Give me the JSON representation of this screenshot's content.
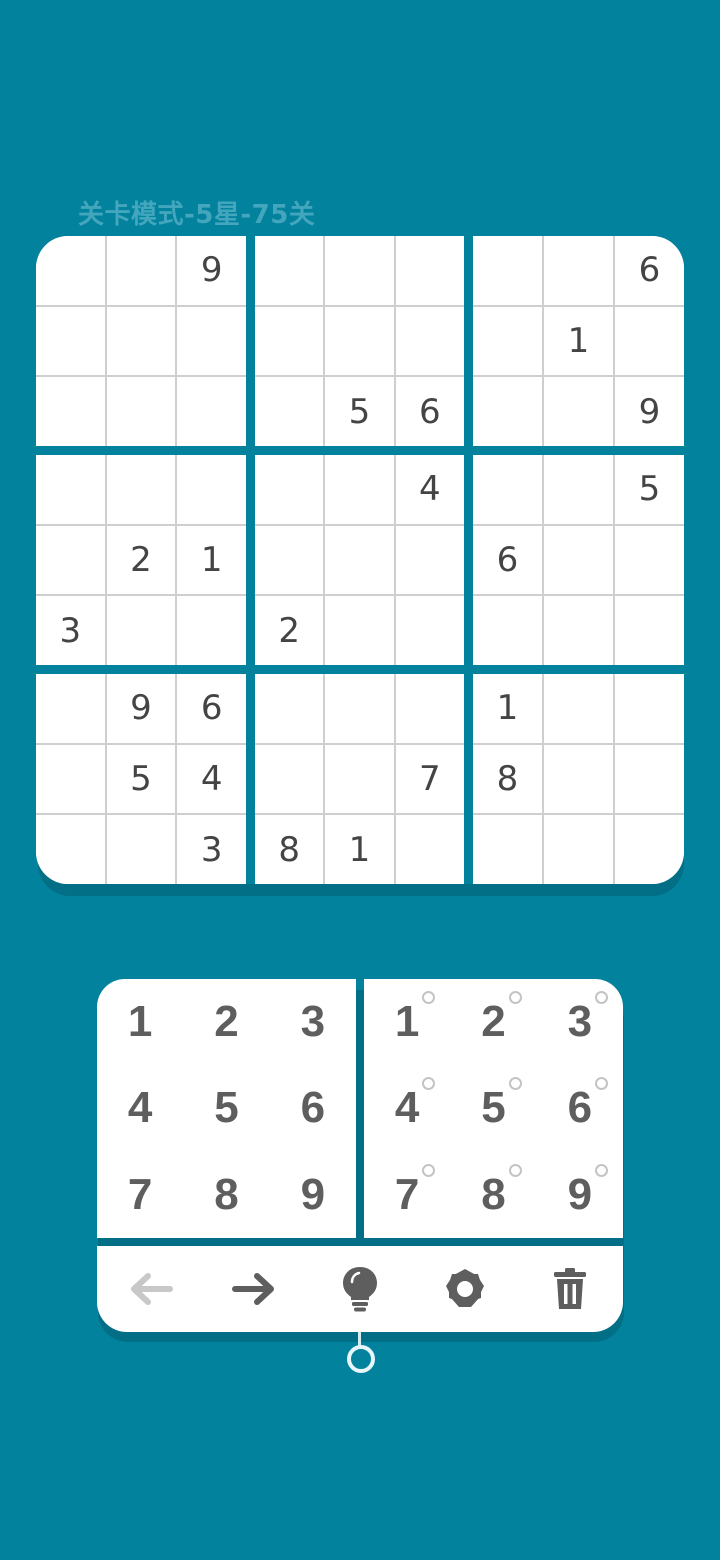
{
  "level_title": "关卡模式-5星-75关",
  "board": {
    "grid": [
      [
        "",
        "",
        "9",
        "",
        "",
        "",
        "",
        "",
        "6"
      ],
      [
        "",
        "",
        "",
        "",
        "",
        "",
        "",
        "1",
        ""
      ],
      [
        "",
        "",
        "",
        "",
        "5",
        "6",
        "",
        "",
        "9"
      ],
      [
        "",
        "",
        "",
        "",
        "",
        "4",
        "",
        "",
        "5"
      ],
      [
        "",
        "2",
        "1",
        "",
        "",
        "",
        "6",
        "",
        ""
      ],
      [
        "3",
        "",
        "",
        "2",
        "",
        "",
        "",
        "",
        ""
      ],
      [
        "",
        "9",
        "6",
        "",
        "",
        "",
        "1",
        "",
        ""
      ],
      [
        "",
        "5",
        "4",
        "",
        "",
        "7",
        "8",
        "",
        ""
      ],
      [
        "",
        "",
        "3",
        "8",
        "1",
        "",
        "",
        "",
        ""
      ]
    ]
  },
  "keypad": {
    "numbers": [
      "1",
      "2",
      "3",
      "4",
      "5",
      "6",
      "7",
      "8",
      "9"
    ],
    "note_numbers": [
      "1",
      "2",
      "3",
      "4",
      "5",
      "6",
      "7",
      "8",
      "9"
    ]
  },
  "toolbar": {
    "tools": [
      {
        "name": "undo-button",
        "icon": "arrow-left-icon",
        "enabled": false
      },
      {
        "name": "redo-button",
        "icon": "arrow-right-icon",
        "enabled": true
      },
      {
        "name": "hint-button",
        "icon": "lightbulb-icon",
        "enabled": true
      },
      {
        "name": "settings-button",
        "icon": "gear-icon",
        "enabled": true
      },
      {
        "name": "delete-button",
        "icon": "trash-icon",
        "enabled": true
      }
    ]
  },
  "colors": {
    "background": "#03829e",
    "title": "#43a6bd",
    "digit": "#444444",
    "icon": "#5e5e5e",
    "icon_disabled": "#c8c8c8"
  }
}
